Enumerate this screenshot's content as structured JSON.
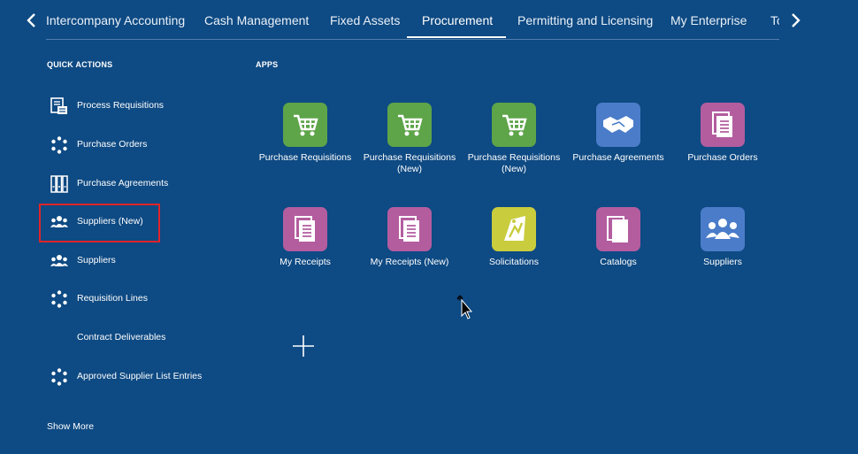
{
  "topnav": {
    "tabs": [
      {
        "label": "Intercompany Accounting"
      },
      {
        "label": "Cash Management"
      },
      {
        "label": "Fixed Assets"
      },
      {
        "label": "Procurement"
      },
      {
        "label": "Permitting and Licensing"
      },
      {
        "label": "My Enterprise"
      },
      {
        "label": "To"
      }
    ],
    "active_tab": "Procurement"
  },
  "quick_actions": {
    "title": "QUICK ACTIONS",
    "items": [
      {
        "label": "Process Requisitions",
        "icon": "document-list-icon"
      },
      {
        "label": "Purchase Orders",
        "icon": "dotted-circle-icon"
      },
      {
        "label": "Purchase Agreements",
        "icon": "binders-icon"
      },
      {
        "label": "Suppliers (New)",
        "icon": "users-group-icon"
      },
      {
        "label": "Suppliers",
        "icon": "users-group-icon"
      },
      {
        "label": "Requisition Lines",
        "icon": "dotted-circle-icon"
      },
      {
        "label": "Contract Deliverables",
        "icon": ""
      },
      {
        "label": "Approved Supplier List Entries",
        "icon": "dotted-circle-icon"
      }
    ],
    "show_more": "Show More"
  },
  "apps": {
    "title": "APPS",
    "tiles": [
      {
        "label": "Purchase Requisitions",
        "icon": "shopping-cart-icon",
        "color": "#5ea449"
      },
      {
        "label": "Purchase Requisitions (New)",
        "icon": "shopping-cart-icon",
        "color": "#5ea449"
      },
      {
        "label": "Purchase Requisitions (New)",
        "icon": "shopping-cart-icon",
        "color": "#5ea449"
      },
      {
        "label": "Purchase Agreements",
        "icon": "handshake-icon",
        "color": "#4b7cc9"
      },
      {
        "label": "Purchase Orders",
        "icon": "document-stack-icon",
        "color": "#b35d9f"
      },
      {
        "label": "My Receipts",
        "icon": "document-stack-icon",
        "color": "#b35d9f"
      },
      {
        "label": "My Receipts (New)",
        "icon": "document-stack-icon",
        "color": "#b35d9f"
      },
      {
        "label": "Solicitations",
        "icon": "solicitation-icon",
        "color": "#c9cc3d"
      },
      {
        "label": "Catalogs",
        "icon": "catalog-pages-icon",
        "color": "#b35d9f"
      },
      {
        "label": "Suppliers",
        "icon": "users-group-icon",
        "color": "#4b7cc9"
      }
    ]
  },
  "colors": {
    "background": "#0e4a83",
    "highlight_border": "#e0242a"
  }
}
